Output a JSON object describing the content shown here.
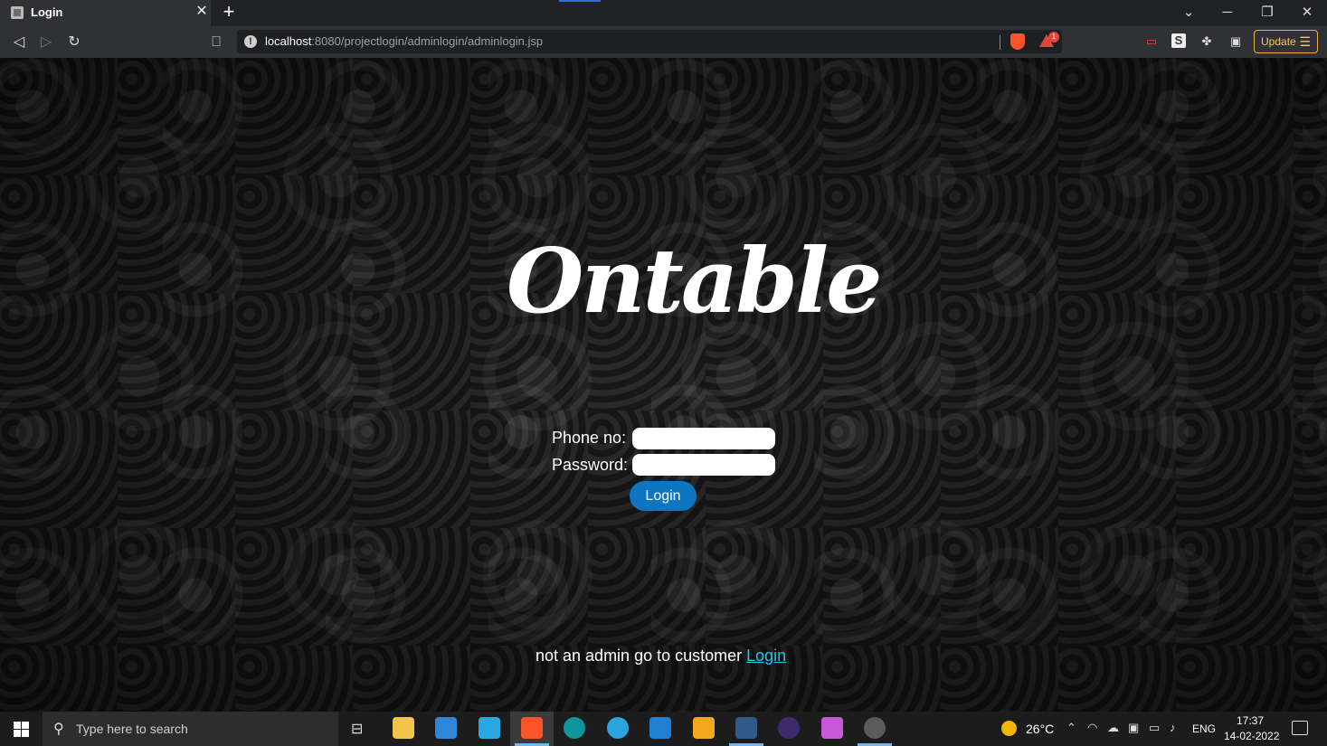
{
  "browser": {
    "tab_title": "Login",
    "tab_close": "✕",
    "new_tab": "+",
    "url_host": "localhost",
    "url_rest": ":8080/projectlogin/adminlogin/adminlogin.jsp",
    "rewards_badge": "1",
    "update_label": "Update"
  },
  "page": {
    "logo_text": "Ontable",
    "phone_label": "Phone no:",
    "phone_value": "",
    "password_label": "Password:",
    "password_value": "",
    "login_button": "Login",
    "footer_text": "not an admin go to customer ",
    "footer_link": "Login"
  },
  "taskbar": {
    "search_placeholder": "Type here to search",
    "temperature": "26°C",
    "language": "ENG",
    "time": "17:37",
    "date": "14-02-2022"
  },
  "colors": {
    "accent_button": "#0e76c0",
    "link": "#1ec8e6",
    "update_border": "#e7b33b"
  }
}
